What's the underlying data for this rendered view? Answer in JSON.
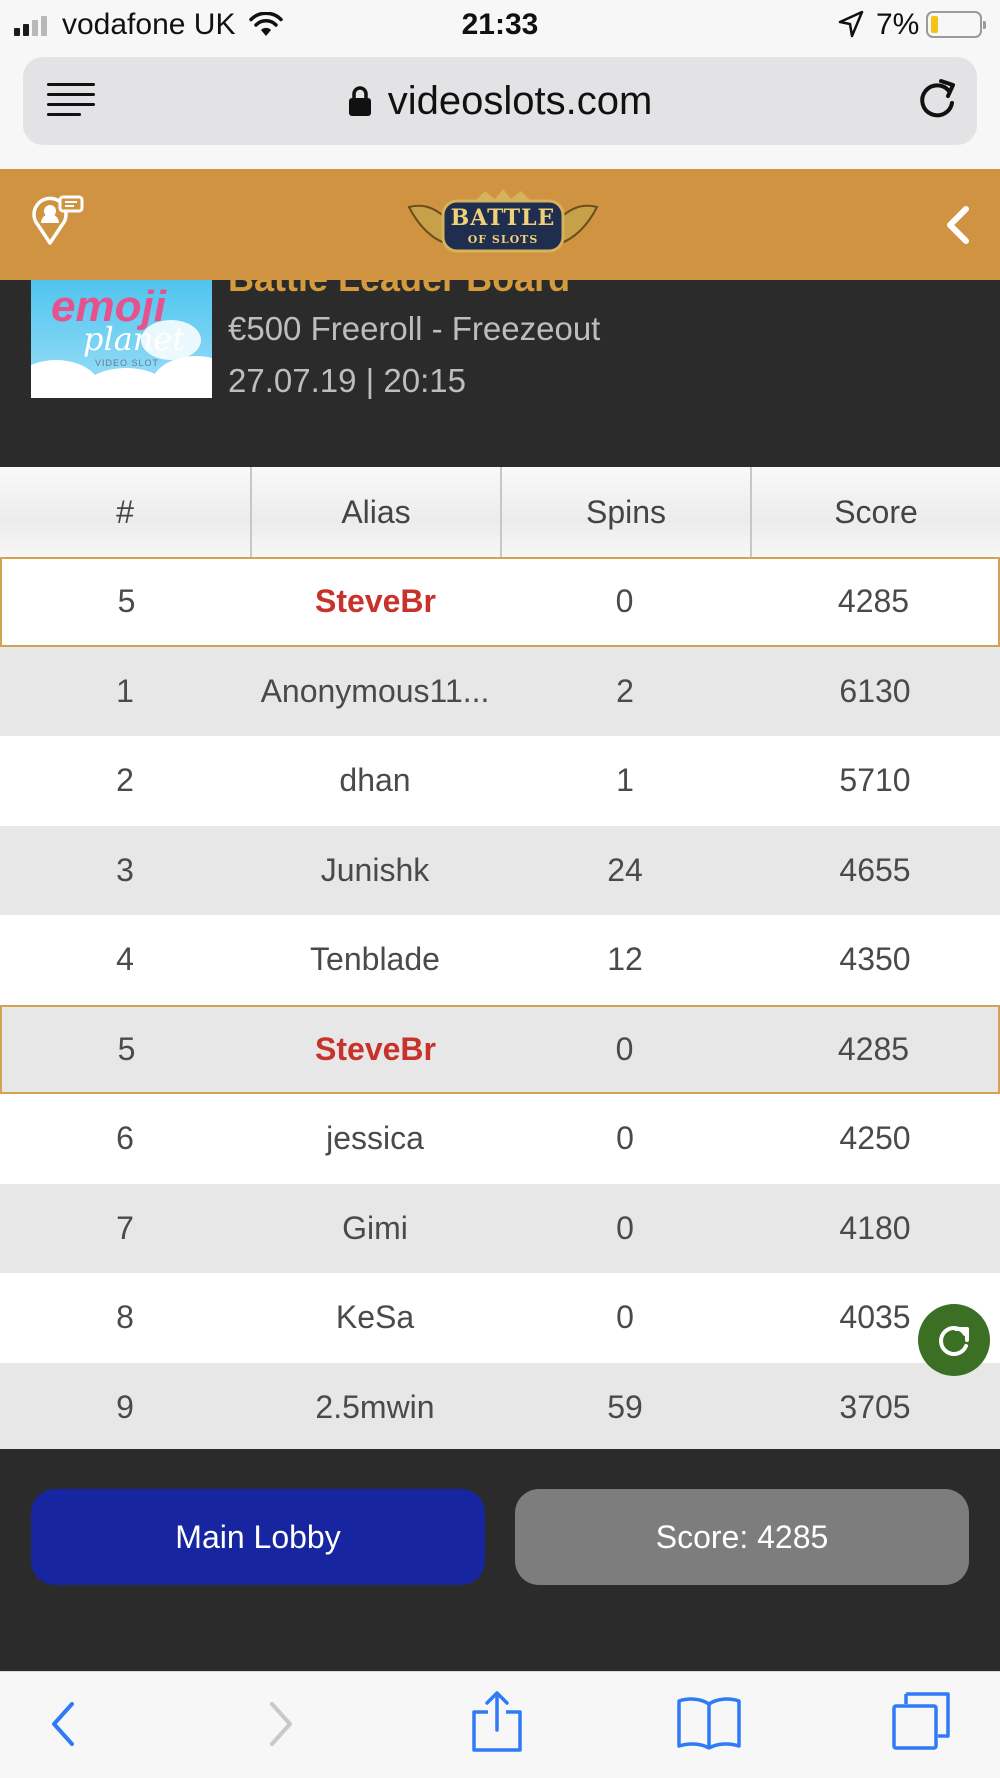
{
  "status_bar": {
    "carrier": "vodafone UK",
    "time": "21:33",
    "battery_percent": "7%",
    "battery_level": 0.07,
    "signal_bars": 2
  },
  "browser": {
    "url": "videoslots.com",
    "icons": [
      "menu-icon",
      "lock-icon",
      "reload-icon"
    ]
  },
  "site_header": {
    "logo_line1": "BATTLE",
    "logo_line2": "OF SLOTS",
    "icons": [
      "support-location-icon",
      "back-chevron-icon"
    ],
    "accent_color": "#cf9342"
  },
  "battle": {
    "title": "Battle Leader Board",
    "game_thumbnail": {
      "line1": "emoji",
      "line2": "planet",
      "line3": "VIDEO SLOT"
    },
    "prize": "€500 Freeroll - Freezeout",
    "datetime": "27.07.19 | 20:15"
  },
  "leaderboard": {
    "columns": [
      "#",
      "Alias",
      "Spins",
      "Score"
    ],
    "current_user": {
      "rank": "5",
      "alias": "SteveBr",
      "spins": "0",
      "score": "4285"
    },
    "rows": [
      {
        "rank": "1",
        "alias": "Anonymous11...",
        "spins": "2",
        "score": "6130"
      },
      {
        "rank": "2",
        "alias": "dhan",
        "spins": "1",
        "score": "5710"
      },
      {
        "rank": "3",
        "alias": "Junishk",
        "spins": "24",
        "score": "4655"
      },
      {
        "rank": "4",
        "alias": "Tenblade",
        "spins": "12",
        "score": "4350"
      },
      {
        "rank": "5",
        "alias": "SteveBr",
        "spins": "0",
        "score": "4285"
      },
      {
        "rank": "6",
        "alias": "jessica",
        "spins": "0",
        "score": "4250"
      },
      {
        "rank": "7",
        "alias": "Gimi",
        "spins": "0",
        "score": "4180"
      },
      {
        "rank": "8",
        "alias": "KeSa",
        "spins": "0",
        "score": "4035"
      },
      {
        "rank": "9",
        "alias": "2.5mwin",
        "spins": "59",
        "score": "3705"
      }
    ],
    "highlight_color": "#c7322b"
  },
  "actions": {
    "main_lobby": "Main Lobby",
    "score_button": "Score: 4285",
    "refresh_icon": "refresh-icon"
  },
  "toolbar": {
    "icons": [
      "back-icon",
      "forward-icon",
      "share-icon",
      "bookmarks-icon",
      "tabs-icon"
    ]
  }
}
